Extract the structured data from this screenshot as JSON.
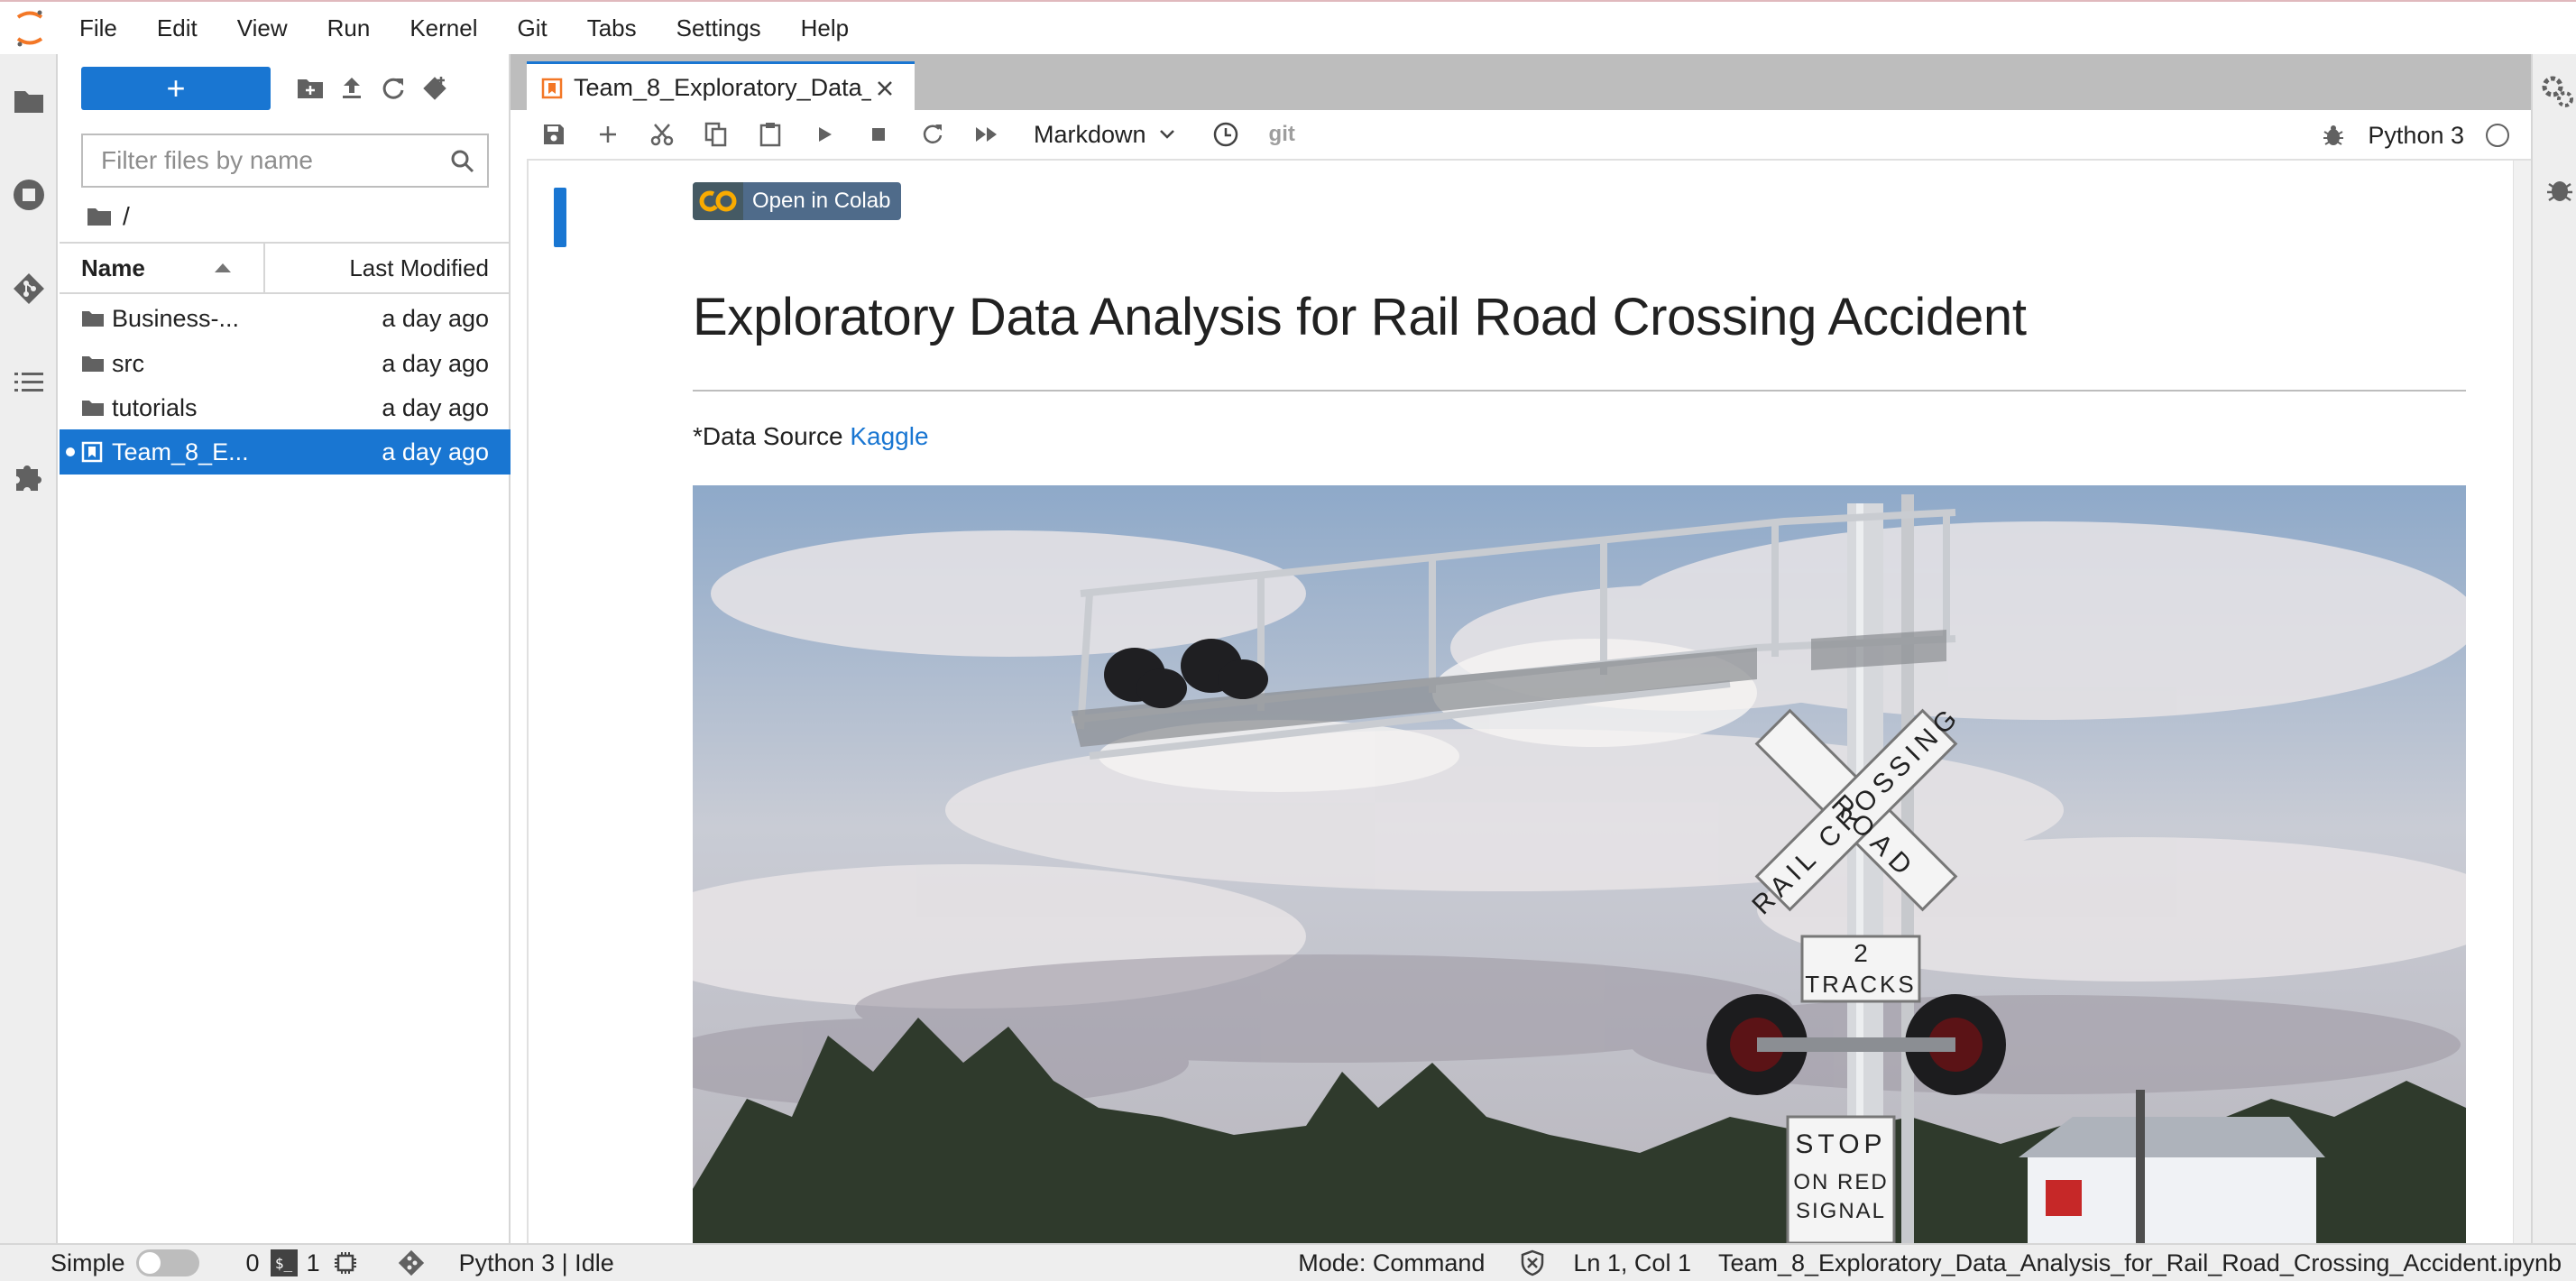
{
  "menubar": {
    "items": [
      "File",
      "Edit",
      "View",
      "Run",
      "Kernel",
      "Git",
      "Tabs",
      "Settings",
      "Help"
    ]
  },
  "activity_bar": {
    "icons": [
      "folder-icon",
      "running-icon",
      "git-icon",
      "toc-icon",
      "extension-icon"
    ]
  },
  "right_activity_bar": {
    "icons": [
      "property-inspector-icon",
      "debugger-icon"
    ]
  },
  "file_browser": {
    "new_button": "+",
    "filter_placeholder": "Filter files by name",
    "breadcrumb": "/",
    "columns": {
      "name": "Name",
      "modified": "Last Modified"
    },
    "rows": [
      {
        "name": "Business-...",
        "type": "folder",
        "modified": "a day ago",
        "selected": false,
        "running": false
      },
      {
        "name": "src",
        "type": "folder",
        "modified": "a day ago",
        "selected": false,
        "running": false
      },
      {
        "name": "tutorials",
        "type": "folder",
        "modified": "a day ago",
        "selected": false,
        "running": false
      },
      {
        "name": "Team_8_E...",
        "type": "notebook",
        "modified": "a day ago",
        "selected": true,
        "running": true
      }
    ]
  },
  "tab": {
    "title": "Team_8_Exploratory_Data_"
  },
  "notebook_toolbar": {
    "cell_type": "Markdown",
    "git_label": "git",
    "kernel_name": "Python 3"
  },
  "notebook": {
    "badge_logo": "CO",
    "badge_text": "Open in Colab",
    "title": "Exploratory Data Analysis for Rail Road Crossing Accident",
    "source_prefix": "*Data Source ",
    "source_link": "Kaggle",
    "image": {
      "crossbuck_top": "RAIL CROSSING",
      "crossbuck_bottom": "ROAD",
      "tracks_number": "2",
      "tracks_label": "TRACKS",
      "stop_sign_line1": "STOP",
      "stop_sign_line2": "ON RED",
      "stop_sign_line3": "SIGNAL"
    }
  },
  "status_bar": {
    "mode_toggle_label": "Simple",
    "terminals_count": "0",
    "kernels_count": "1",
    "kernel_status": "Python 3 | Idle",
    "mode": "Mode: Command",
    "cursor": "Ln 1, Col 1",
    "filename": "Team_8_Exploratory_Data_Analysis_for_Rail_Road_Crossing_Accident.ipynb"
  },
  "colors": {
    "accent": "#1976d2",
    "jupyter_orange": "#f37726",
    "panel_bg": "#eeeeee"
  }
}
